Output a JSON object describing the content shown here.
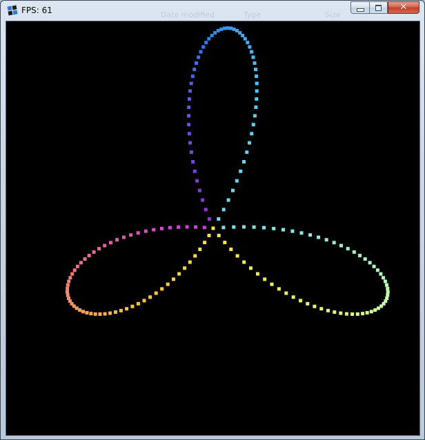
{
  "window": {
    "title": "FPS: 61",
    "background_text": [
      "Date modified",
      "Type",
      "Size"
    ],
    "close_glyph": "✕",
    "app_icon": "app-icon"
  },
  "canvas": {
    "background": "#000000",
    "figure": "trefoil-rose-dotted",
    "dot_count": 180,
    "colors": [
      "#9b2bd8",
      "#2a7cf0",
      "#56c8f0",
      "#88e8e0",
      "#c8ffa8",
      "#f4f050",
      "#ffc040",
      "#f07a78",
      "#c83ce0"
    ]
  }
}
